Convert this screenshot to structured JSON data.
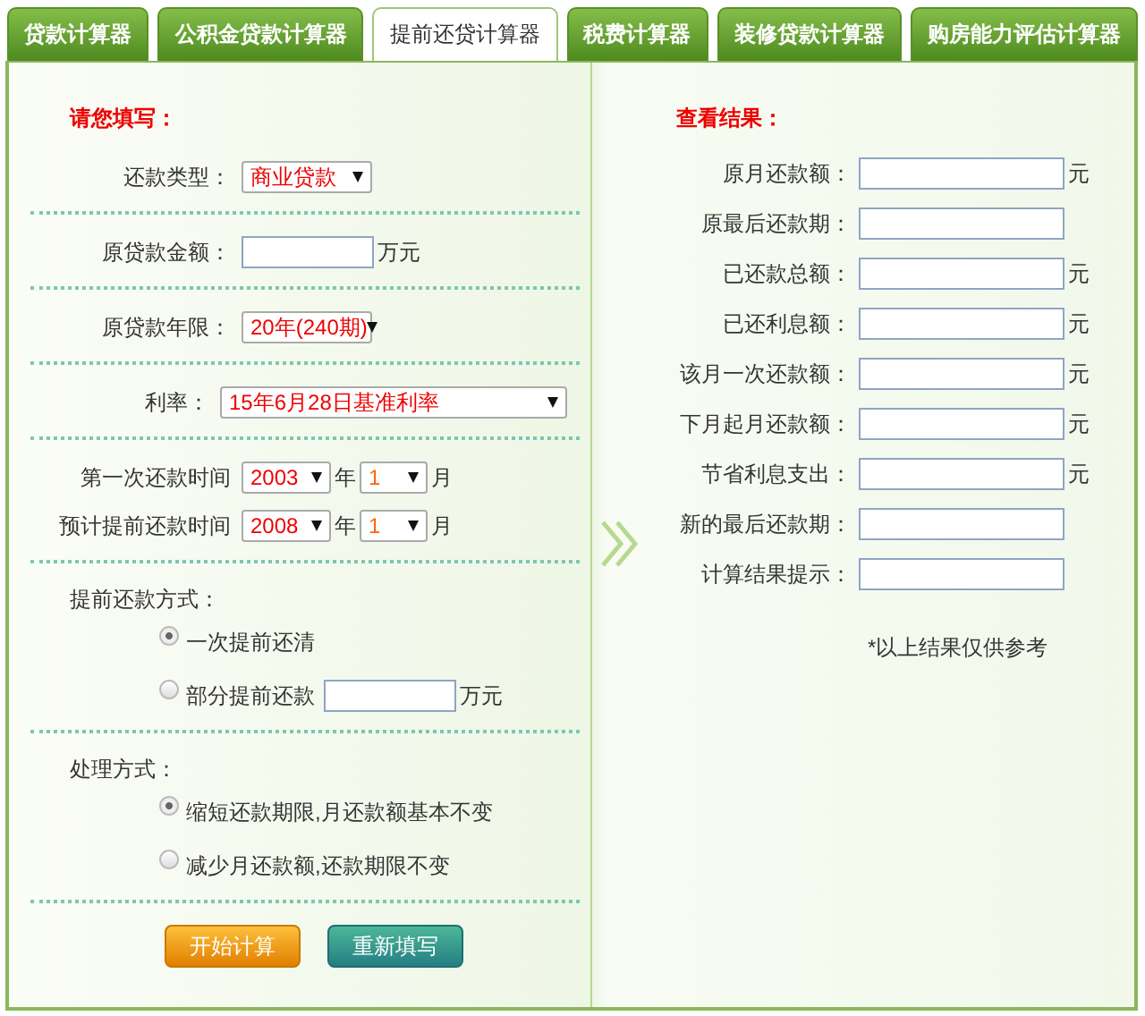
{
  "tabs": [
    {
      "label": "贷款计算器",
      "selected": false
    },
    {
      "label": "公积金贷款计算器",
      "selected": false
    },
    {
      "label": "提前还贷计算器",
      "selected": true
    },
    {
      "label": "税费计算器",
      "selected": false
    },
    {
      "label": "装修贷款计算器",
      "selected": false
    },
    {
      "label": "购房能力评估计算器",
      "selected": false
    }
  ],
  "form": {
    "heading": "请您填写：",
    "sections": [
      {
        "kind": "select",
        "label": "还款类型：",
        "value": "商业贷款"
      },
      {
        "kind": "input",
        "label": "原贷款金额：",
        "unit": "万元"
      },
      {
        "kind": "select",
        "label": "原贷款年限：",
        "value": "20年(240期)"
      },
      {
        "kind": "wide-select",
        "label": "利率：",
        "value": "15年6月28日基准利率"
      },
      {
        "kind": "dates",
        "items": [
          {
            "label": "第一次还款时间",
            "year": "2003",
            "year_unit": "年",
            "month": "1",
            "month_unit": "月"
          },
          {
            "label": "预计提前还款时间",
            "year": "2008",
            "year_unit": "年",
            "month": "1",
            "month_unit": "月"
          }
        ]
      },
      {
        "kind": "radios",
        "label": "提前还款方式：",
        "options": [
          {
            "label": "一次提前还清",
            "selected": true
          },
          {
            "label": "部分提前还款",
            "selected": false,
            "unit": "万元"
          }
        ]
      },
      {
        "kind": "radios",
        "label": "处理方式：",
        "options": [
          {
            "label": "缩短还款期限,月还款额基本不变",
            "selected": true
          },
          {
            "label": "减少月还款额,还款期限不变",
            "selected": false
          }
        ]
      }
    ],
    "buttons": [
      {
        "label": "开始计算",
        "kind": "primary"
      },
      {
        "label": "重新填写",
        "kind": "secondary"
      }
    ]
  },
  "results": {
    "heading": "查看结果：",
    "rows": [
      {
        "label": "原月还款额：",
        "unit": "元"
      },
      {
        "label": "原最后还款期："
      },
      {
        "label": "已还款总额：",
        "unit": "元"
      },
      {
        "label": "已还利息额：",
        "unit": "元"
      },
      {
        "label": "该月一次还款额：",
        "unit": "元"
      },
      {
        "label": "下月起月还款额：",
        "unit": "元"
      },
      {
        "label": "节省利息支出：",
        "unit": "元"
      },
      {
        "label": "新的最后还款期："
      },
      {
        "label": "计算结果提示："
      }
    ],
    "note": "*以上结果仅供参考"
  }
}
